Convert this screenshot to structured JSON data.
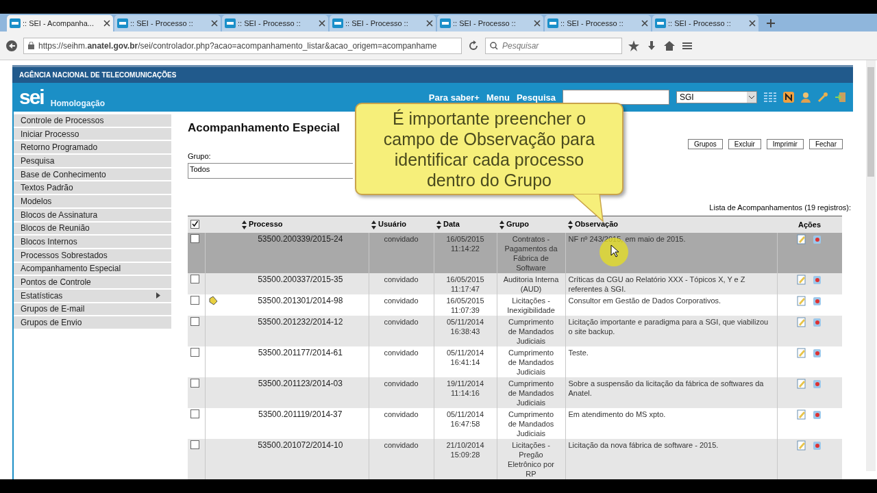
{
  "browser": {
    "tabs": [
      {
        "label": ":: SEI - Acompanha...",
        "selected": true
      },
      {
        "label": ":: SEI - Processo ::",
        "selected": false
      },
      {
        "label": ":: SEI - Processo ::",
        "selected": false
      },
      {
        "label": ":: SEI - Processo ::",
        "selected": false
      },
      {
        "label": ":: SEI - Processo ::",
        "selected": false
      },
      {
        "label": ":: SEI - Processo ::",
        "selected": false
      },
      {
        "label": ":: SEI - Processo ::",
        "selected": false
      }
    ],
    "url": "https://seihm.**anatel.gov.br**/sei/controlador.php?acao=acompanhamento_listar&acao_origem=acompanhame",
    "search_placeholder": "Pesquisar"
  },
  "header": {
    "agency": "AGÊNCIA NACIONAL DE TELECOMUNICAÇÕES",
    "logo": "sei",
    "environment": "Homologação",
    "links": [
      "Para saber+",
      "Menu",
      "Pesquisa"
    ],
    "unit": "SGI"
  },
  "sidebar": {
    "items": [
      {
        "label": "Controle de Processos",
        "submenu": false
      },
      {
        "label": "Iniciar Processo",
        "submenu": false
      },
      {
        "label": "Retorno Programado",
        "submenu": false
      },
      {
        "label": "Pesquisa",
        "submenu": false
      },
      {
        "label": "Base de Conhecimento",
        "submenu": false
      },
      {
        "label": "Textos Padrão",
        "submenu": false
      },
      {
        "label": "Modelos",
        "submenu": false
      },
      {
        "label": "Blocos de Assinatura",
        "submenu": false
      },
      {
        "label": "Blocos de Reunião",
        "submenu": false
      },
      {
        "label": "Blocos Internos",
        "submenu": false
      },
      {
        "label": "Processos Sobrestados",
        "submenu": false
      },
      {
        "label": "Acompanhamento Especial",
        "submenu": false
      },
      {
        "label": "Pontos de Controle",
        "submenu": false
      },
      {
        "label": "Estatísticas",
        "submenu": true
      },
      {
        "label": "Grupos de E-mail",
        "submenu": false
      },
      {
        "label": "Grupos de Envio",
        "submenu": false
      }
    ]
  },
  "page": {
    "title": "Acompanhamento Especial",
    "buttons": [
      "Grupos",
      "Excluir",
      "Imprimir",
      "Fechar"
    ],
    "group_label": "Grupo:",
    "group_value": "Todos",
    "list_caption": "Lista de Acompanhamentos (19 registros):"
  },
  "table": {
    "all_checked": true,
    "columns": [
      "Processo",
      "Usuário",
      "Data",
      "Grupo",
      "Observação",
      "Ações"
    ],
    "rows": [
      {
        "processo": "53500.200339/2015-24",
        "usuario": "convidado",
        "data": "16/05/2015 11:14:22",
        "grupo": "Contratos - Pagamentos da Fábrica de Software",
        "observacao": "NF nº 243/2015, em maio de 2015.",
        "checked": false,
        "highlighted": true,
        "annotated": false
      },
      {
        "processo": "53500.200337/2015-35",
        "usuario": "convidado",
        "data": "16/05/2015 11:17:47",
        "grupo": "Auditoria Interna (AUD)",
        "observacao": "Críticas da CGU ao Relatório XXX - Tópicos X, Y e Z referentes à SGI.",
        "checked": false,
        "highlighted": false,
        "annotated": false
      },
      {
        "processo": "53500.201301/2014-98",
        "usuario": "convidado",
        "data": "16/05/2015 11:07:39",
        "grupo": "Licitações - Inexigibilidade",
        "observacao": "Consultor em Gestão de Dados Corporativos.",
        "checked": false,
        "highlighted": false,
        "annotated": true
      },
      {
        "processo": "53500.201232/2014-12",
        "usuario": "convidado",
        "data": "05/11/2014 16:38:43",
        "grupo": "Cumprimento de Mandados Judiciais",
        "observacao": "Licitação importante e paradigma para a SGI, que viabilizou o site backup.",
        "checked": false,
        "highlighted": false,
        "annotated": false
      },
      {
        "processo": "53500.201177/2014-61",
        "usuario": "convidado",
        "data": "05/11/2014 16:41:14",
        "grupo": "Cumprimento de Mandados Judiciais",
        "observacao": "Teste.",
        "checked": false,
        "highlighted": false,
        "annotated": false
      },
      {
        "processo": "53500.201123/2014-03",
        "usuario": "convidado",
        "data": "19/11/2014 11:14:16",
        "grupo": "Cumprimento de Mandados Judiciais",
        "observacao": "Sobre a suspensão da licitação da fábrica de softwares da Anatel.",
        "checked": false,
        "highlighted": false,
        "annotated": false
      },
      {
        "processo": "53500.201119/2014-37",
        "usuario": "convidado",
        "data": "05/11/2014 16:47:58",
        "grupo": "Cumprimento de Mandados Judiciais",
        "observacao": "Em atendimento do MS xpto.",
        "checked": false,
        "highlighted": false,
        "annotated": false
      },
      {
        "processo": "53500.201072/2014-10",
        "usuario": "convidado",
        "data": "21/10/2014 15:09:28",
        "grupo": "Licitações - Pregão Eletrônico por RP",
        "observacao": "Licitação da nova fábrica de software - 2015.",
        "checked": false,
        "highlighted": false,
        "annotated": false
      }
    ]
  },
  "callout": "É importante preencher o campo de Observação para identificar cada processo dentro do Grupo"
}
